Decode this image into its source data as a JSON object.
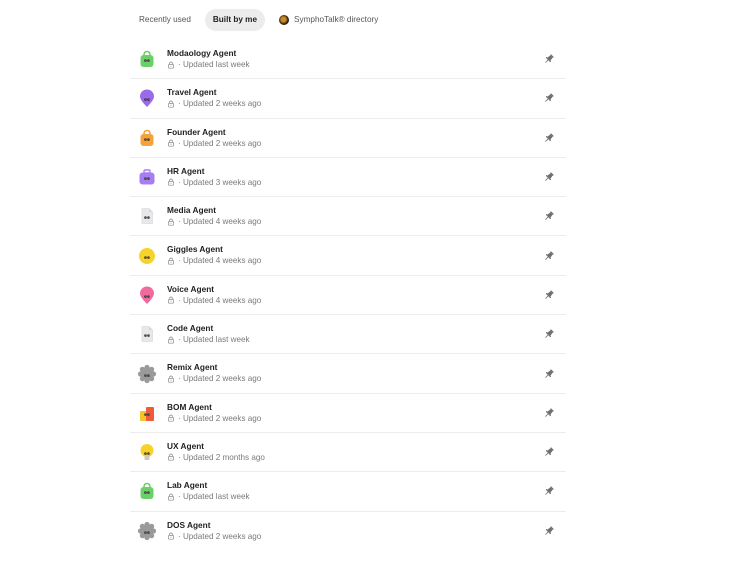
{
  "tabs": [
    {
      "label": "Recently used",
      "active": false
    },
    {
      "label": "Built by me",
      "active": true
    },
    {
      "label": "SymphoTalk® directory",
      "active": false,
      "icon": "symphotalk-logo-icon"
    }
  ],
  "agents": [
    {
      "name": "Modaology Agent",
      "updated": "· Updated last week",
      "icon": "green-bag-icon",
      "color": "#6ccf6a"
    },
    {
      "name": "Travel Agent",
      "updated": "· Updated 2 weeks ago",
      "icon": "purple-pin-icon",
      "color": "#9a6ae8"
    },
    {
      "name": "Founder Agent",
      "updated": "· Updated 2 weeks ago",
      "icon": "orange-bag-icon",
      "color": "#f5a23a"
    },
    {
      "name": "HR Agent",
      "updated": "· Updated 3 weeks ago",
      "icon": "purple-briefcase-icon",
      "color": "#a77ef0"
    },
    {
      "name": "Media Agent",
      "updated": "· Updated 4 weeks ago",
      "icon": "white-document-icon",
      "color": "#e8e8ea"
    },
    {
      "name": "Giggles Agent",
      "updated": "· Updated 4 weeks ago",
      "icon": "yellow-smiley-icon",
      "color": "#f6d22a"
    },
    {
      "name": "Voice Agent",
      "updated": "· Updated 4 weeks ago",
      "icon": "pink-heart-icon",
      "color": "#f06aa0"
    },
    {
      "name": "Code Agent",
      "updated": "· Updated last week",
      "icon": "white-document-icon",
      "color": "#e8e8ea"
    },
    {
      "name": "Remix Agent",
      "updated": "· Updated 2 weeks ago",
      "icon": "gray-gear-icon",
      "color": "#9a9a9a"
    },
    {
      "name": "BOM Agent",
      "updated": "· Updated 2 weeks ago",
      "icon": "red-yellow-blocks-icon",
      "color": "#ef5a3a"
    },
    {
      "name": "UX Agent",
      "updated": "· Updated 2 months ago",
      "icon": "yellow-lightbulb-icon",
      "color": "#f6d22a"
    },
    {
      "name": "Lab Agent",
      "updated": "· Updated last week",
      "icon": "green-bag-icon",
      "color": "#6ccf6a"
    },
    {
      "name": "DOS Agent",
      "updated": "· Updated 2 weeks ago",
      "icon": "gray-gear-icon",
      "color": "#9a9a9a"
    }
  ]
}
